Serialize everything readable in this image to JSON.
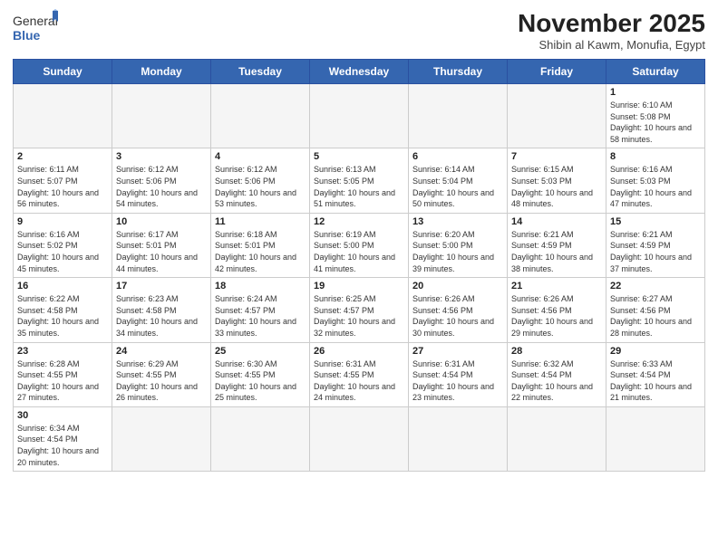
{
  "logo": {
    "text_normal": "General",
    "text_bold": "Blue"
  },
  "header": {
    "month": "November 2025",
    "location": "Shibin al Kawm, Monufia, Egypt"
  },
  "weekdays": [
    "Sunday",
    "Monday",
    "Tuesday",
    "Wednesday",
    "Thursday",
    "Friday",
    "Saturday"
  ],
  "weeks": [
    [
      {
        "day": "",
        "empty": true
      },
      {
        "day": "",
        "empty": true
      },
      {
        "day": "",
        "empty": true
      },
      {
        "day": "",
        "empty": true
      },
      {
        "day": "",
        "empty": true
      },
      {
        "day": "",
        "empty": true
      },
      {
        "day": "1",
        "sunrise": "6:10 AM",
        "sunset": "5:08 PM",
        "daylight": "10 hours and 58 minutes."
      }
    ],
    [
      {
        "day": "2",
        "sunrise": "6:11 AM",
        "sunset": "5:07 PM",
        "daylight": "10 hours and 56 minutes."
      },
      {
        "day": "3",
        "sunrise": "6:12 AM",
        "sunset": "5:06 PM",
        "daylight": "10 hours and 54 minutes."
      },
      {
        "day": "4",
        "sunrise": "6:12 AM",
        "sunset": "5:06 PM",
        "daylight": "10 hours and 53 minutes."
      },
      {
        "day": "5",
        "sunrise": "6:13 AM",
        "sunset": "5:05 PM",
        "daylight": "10 hours and 51 minutes."
      },
      {
        "day": "6",
        "sunrise": "6:14 AM",
        "sunset": "5:04 PM",
        "daylight": "10 hours and 50 minutes."
      },
      {
        "day": "7",
        "sunrise": "6:15 AM",
        "sunset": "5:03 PM",
        "daylight": "10 hours and 48 minutes."
      },
      {
        "day": "8",
        "sunrise": "6:16 AM",
        "sunset": "5:03 PM",
        "daylight": "10 hours and 47 minutes."
      }
    ],
    [
      {
        "day": "9",
        "sunrise": "6:16 AM",
        "sunset": "5:02 PM",
        "daylight": "10 hours and 45 minutes."
      },
      {
        "day": "10",
        "sunrise": "6:17 AM",
        "sunset": "5:01 PM",
        "daylight": "10 hours and 44 minutes."
      },
      {
        "day": "11",
        "sunrise": "6:18 AM",
        "sunset": "5:01 PM",
        "daylight": "10 hours and 42 minutes."
      },
      {
        "day": "12",
        "sunrise": "6:19 AM",
        "sunset": "5:00 PM",
        "daylight": "10 hours and 41 minutes."
      },
      {
        "day": "13",
        "sunrise": "6:20 AM",
        "sunset": "5:00 PM",
        "daylight": "10 hours and 39 minutes."
      },
      {
        "day": "14",
        "sunrise": "6:21 AM",
        "sunset": "4:59 PM",
        "daylight": "10 hours and 38 minutes."
      },
      {
        "day": "15",
        "sunrise": "6:21 AM",
        "sunset": "4:59 PM",
        "daylight": "10 hours and 37 minutes."
      }
    ],
    [
      {
        "day": "16",
        "sunrise": "6:22 AM",
        "sunset": "4:58 PM",
        "daylight": "10 hours and 35 minutes."
      },
      {
        "day": "17",
        "sunrise": "6:23 AM",
        "sunset": "4:58 PM",
        "daylight": "10 hours and 34 minutes."
      },
      {
        "day": "18",
        "sunrise": "6:24 AM",
        "sunset": "4:57 PM",
        "daylight": "10 hours and 33 minutes."
      },
      {
        "day": "19",
        "sunrise": "6:25 AM",
        "sunset": "4:57 PM",
        "daylight": "10 hours and 32 minutes."
      },
      {
        "day": "20",
        "sunrise": "6:26 AM",
        "sunset": "4:56 PM",
        "daylight": "10 hours and 30 minutes."
      },
      {
        "day": "21",
        "sunrise": "6:26 AM",
        "sunset": "4:56 PM",
        "daylight": "10 hours and 29 minutes."
      },
      {
        "day": "22",
        "sunrise": "6:27 AM",
        "sunset": "4:56 PM",
        "daylight": "10 hours and 28 minutes."
      }
    ],
    [
      {
        "day": "23",
        "sunrise": "6:28 AM",
        "sunset": "4:55 PM",
        "daylight": "10 hours and 27 minutes."
      },
      {
        "day": "24",
        "sunrise": "6:29 AM",
        "sunset": "4:55 PM",
        "daylight": "10 hours and 26 minutes."
      },
      {
        "day": "25",
        "sunrise": "6:30 AM",
        "sunset": "4:55 PM",
        "daylight": "10 hours and 25 minutes."
      },
      {
        "day": "26",
        "sunrise": "6:31 AM",
        "sunset": "4:55 PM",
        "daylight": "10 hours and 24 minutes."
      },
      {
        "day": "27",
        "sunrise": "6:31 AM",
        "sunset": "4:54 PM",
        "daylight": "10 hours and 23 minutes."
      },
      {
        "day": "28",
        "sunrise": "6:32 AM",
        "sunset": "4:54 PM",
        "daylight": "10 hours and 22 minutes."
      },
      {
        "day": "29",
        "sunrise": "6:33 AM",
        "sunset": "4:54 PM",
        "daylight": "10 hours and 21 minutes."
      }
    ],
    [
      {
        "day": "30",
        "sunrise": "6:34 AM",
        "sunset": "4:54 PM",
        "daylight": "10 hours and 20 minutes."
      },
      {
        "day": "",
        "empty": true
      },
      {
        "day": "",
        "empty": true
      },
      {
        "day": "",
        "empty": true
      },
      {
        "day": "",
        "empty": true
      },
      {
        "day": "",
        "empty": true
      },
      {
        "day": "",
        "empty": true
      }
    ]
  ],
  "labels": {
    "sunrise": "Sunrise:",
    "sunset": "Sunset:",
    "daylight": "Daylight:"
  }
}
